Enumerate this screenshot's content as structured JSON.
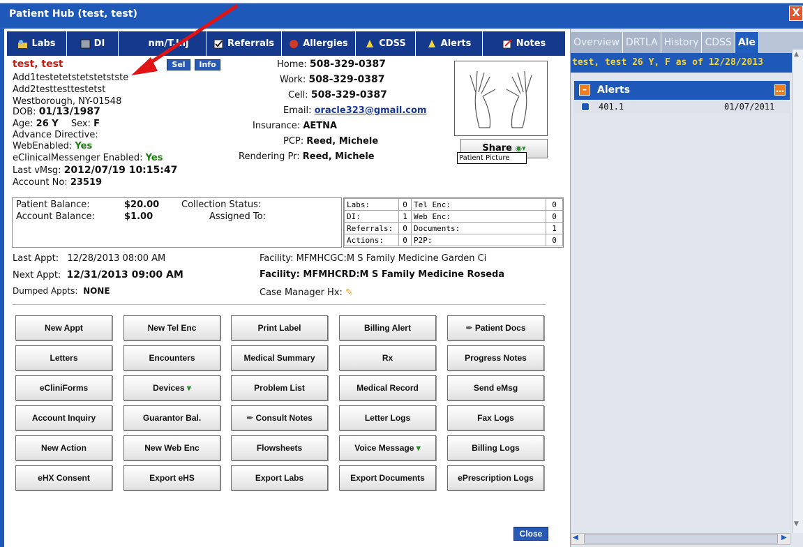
{
  "window": {
    "title": "Patient Hub (test, test)",
    "close_glyph": "X"
  },
  "tabs": [
    {
      "label": "Labs",
      "icon": "labs-icon"
    },
    {
      "label": "DI",
      "icon": "di-icon"
    },
    {
      "label": "nm/T.Inj",
      "icon": "immunization-icon"
    },
    {
      "label": "Referrals",
      "icon": "referrals-check-icon"
    },
    {
      "label": "Allergies",
      "icon": "allergies-icon"
    },
    {
      "label": "CDSS",
      "icon": "bell-icon"
    },
    {
      "label": "Alerts",
      "icon": "bell-icon"
    },
    {
      "label": "Notes",
      "icon": "notes-icon"
    }
  ],
  "patient": {
    "name": "test, test",
    "sel_label": "Sel",
    "info_label": "Info",
    "address1": "Add1testetetstetstetstste",
    "address2": "Add2testtesttestetst",
    "city_line": "Westborough, NY-01548",
    "dob_label": "DOB:",
    "dob": "01/13/1987",
    "age_label": "Age:",
    "age": "26 Y",
    "sex_label": "Sex:",
    "sex": "F",
    "advance_directive": "Advance Directive:",
    "web_enabled_label": "WebEnabled:",
    "web_enabled": "Yes",
    "messenger_label": "eClinicalMessenger Enabled:",
    "messenger": "Yes",
    "last_vmsg_label": "Last vMsg:",
    "last_vmsg": "2012/07/19 10:15:47",
    "account_label": "Account No:",
    "account_no": "23519"
  },
  "contact": {
    "home_label": "Home:",
    "home": "508-329-0387",
    "work_label": "Work:",
    "work": "508-329-0387",
    "cell_label": "Cell:",
    "cell": "508-329-0387",
    "email_label": "Email:",
    "email": "oracle323@gmail.com",
    "insurance_label": "Insurance:",
    "insurance": "AETNA",
    "pcp_label": "PCP:",
    "pcp": "Reed, Michele",
    "rendering_label": "Rendering Pr:",
    "rendering": "Reed, Michele"
  },
  "share": {
    "label": "Share",
    "tooltip": "Patient Picture"
  },
  "balance": {
    "patient_label": "Patient Balance:",
    "patient": "$20.00",
    "account_label": "Account Balance:",
    "account": "$1.00",
    "collection_label": "Collection Status:",
    "assigned_label": "Assigned To:"
  },
  "counts": [
    [
      "Labs:",
      "0",
      "Tel Enc:",
      "0"
    ],
    [
      "DI:",
      "1",
      "Web Enc:",
      "0"
    ],
    [
      "Referrals:",
      "0",
      "Documents:",
      "1"
    ],
    [
      "Actions:",
      "0",
      "P2P:",
      "0"
    ]
  ],
  "appts": {
    "last_label": "Last Appt:",
    "last": "12/28/2013 08:00 AM",
    "last_facility": "Facility: MFMHCGC:M S Family Medicine Garden Ci",
    "next_label": "Next Appt:",
    "next": "12/31/2013 09:00 AM",
    "next_facility": "Facility: MFMHCRD:M S Family Medicine Roseda",
    "dumped_label": "Dumped Appts:",
    "dumped": "NONE",
    "case_manager": "Case Manager Hx:"
  },
  "buttons": [
    [
      "New Appt",
      "New Tel Enc",
      "Print Label",
      "Billing Alert",
      "Patient Docs"
    ],
    [
      "Letters",
      "Encounters",
      "Medical Summary",
      "Rx",
      "Progress Notes"
    ],
    [
      "eCliniForms",
      "Devices",
      "Problem List",
      "Medical Record",
      "Send eMsg"
    ],
    [
      "Account Inquiry",
      "Guarantor Bal.",
      "Consult Notes",
      "Letter Logs",
      "Fax Logs"
    ],
    [
      "New Action",
      "New Web Enc",
      "Flowsheets",
      "Voice Message",
      "Billing Logs"
    ],
    [
      "eHX Consent",
      "Export eHS",
      "Export Labs",
      "Export Documents",
      "ePrescription Logs"
    ]
  ],
  "close_label": "Close",
  "right": {
    "tabs": [
      "Overview",
      "DRTLA",
      "History",
      "CDSS",
      "Ale"
    ],
    "header": "test, test 26 Y, F as of 12/28/2013",
    "alerts_title": "Alerts",
    "alert_code": "401.1",
    "alert_date": "01/07/2011"
  }
}
